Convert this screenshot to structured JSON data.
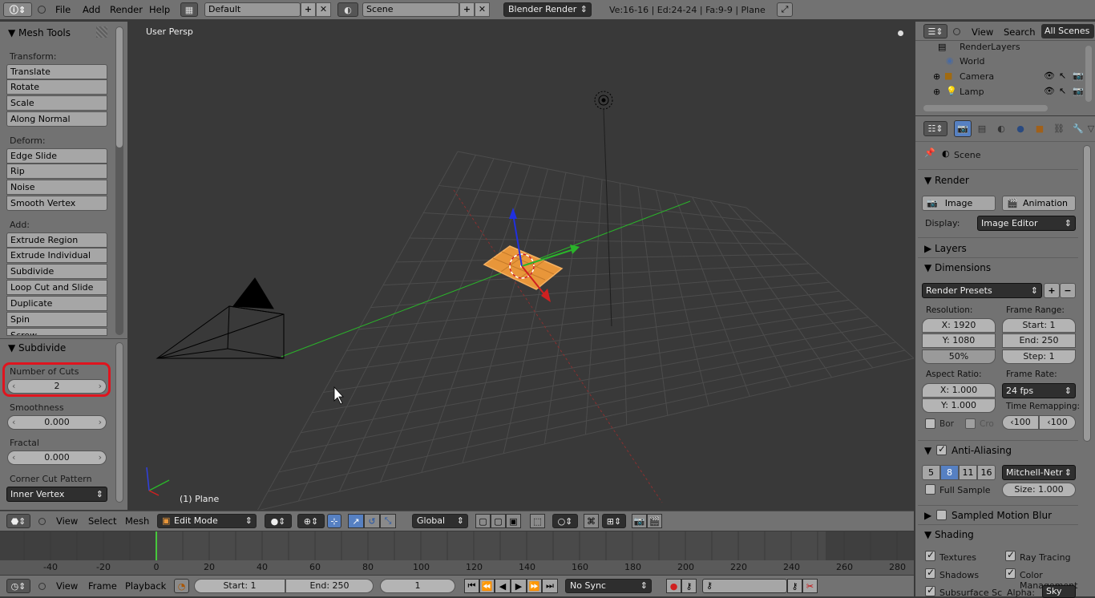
{
  "topbar": {
    "menus": [
      "File",
      "Add",
      "Render",
      "Help"
    ],
    "screen_layout": "Default",
    "scene": "Scene",
    "engine": "Blender Render",
    "stats": "Ve:16-16 | Ed:24-24 | Fa:9-9 | Plane"
  },
  "tools": {
    "panel_title": "Mesh Tools",
    "transform_label": "Transform:",
    "transform": [
      "Translate",
      "Rotate",
      "Scale",
      "Along Normal"
    ],
    "deform_label": "Deform:",
    "deform": [
      "Edge Slide",
      "Rip",
      "Noise",
      "Smooth Vertex"
    ],
    "add_label": "Add:",
    "add": [
      "Extrude Region",
      "Extrude Individual",
      "Subdivide",
      "Loop Cut and Slide",
      "Duplicate",
      "Spin",
      "Screw"
    ],
    "op_title": "Subdivide",
    "cuts_label": "Number of Cuts",
    "cuts_value": "2",
    "smoothness_label": "Smoothness",
    "smoothness_value": "0.000",
    "fractal_label": "Fractal",
    "fractal_value": "0.000",
    "corner_label": "Corner Cut Pattern",
    "corner_value": "Inner Vertex"
  },
  "viewport": {
    "view_name": "User Persp",
    "object_label": "(1) Plane"
  },
  "view_header": {
    "menus": [
      "View",
      "Select",
      "Mesh"
    ],
    "mode": "Edit Mode",
    "orientation": "Global"
  },
  "timeline": {
    "ticks": [
      "-40",
      "-20",
      "0",
      "20",
      "40",
      "60",
      "80",
      "100",
      "120",
      "140",
      "160",
      "180",
      "200",
      "220",
      "240",
      "260",
      "280"
    ],
    "current_frame_marker": 0,
    "menus": [
      "View",
      "Frame",
      "Playback"
    ],
    "start": "Start: 1",
    "end": "End: 250",
    "current": "1",
    "sync": "No Sync"
  },
  "outliner": {
    "view": "View",
    "search": "Search",
    "filter": "All Scenes",
    "items": [
      "RenderLayers",
      "World",
      "Camera",
      "Lamp"
    ]
  },
  "properties": {
    "context": "Scene",
    "render_title": "Render",
    "image_btn": "Image",
    "animation_btn": "Animation",
    "display_label": "Display:",
    "display_value": "Image Editor",
    "layers_title": "Layers",
    "dimensions_title": "Dimensions",
    "presets": "Render Presets",
    "resolution_label": "Resolution:",
    "res_x": "X: 1920",
    "res_y": "Y: 1080",
    "res_pct": "50%",
    "frame_range_label": "Frame Range:",
    "start": "Start: 1",
    "end": "End: 250",
    "step": "Step: 1",
    "aspect_label": "Aspect Ratio:",
    "aspect_x": "X: 1.000",
    "aspect_y": "Y: 1.000",
    "frame_rate_label": "Frame Rate:",
    "frame_rate": "24 fps",
    "bor": "Bor",
    "cro": "Cro",
    "time_remap_label": "Time Remapping:",
    "remap_old": "100",
    "remap_new": "100",
    "aa_title": "Anti-Aliasing",
    "aa_samples": [
      "5",
      "8",
      "11",
      "16"
    ],
    "aa_filter": "Mitchell-Netr",
    "full_sample": "Full Sample",
    "size": "Size: 1.000",
    "motion_blur_title": "Sampled Motion Blur",
    "shading_title": "Shading",
    "textures": "Textures",
    "ray_tracing": "Ray Tracing",
    "shadows": "Shadows",
    "color_management": "Color Management",
    "subsurface": "Subsurface Sc",
    "alpha_label": "Alpha:",
    "alpha_value": "Sky"
  },
  "colors": {
    "highlight_red": "#e0141e",
    "selected_orange": "#e8963a",
    "axis_green": "#2ab42a",
    "axis_red": "#c83232",
    "active_blue": "#5680c2"
  }
}
